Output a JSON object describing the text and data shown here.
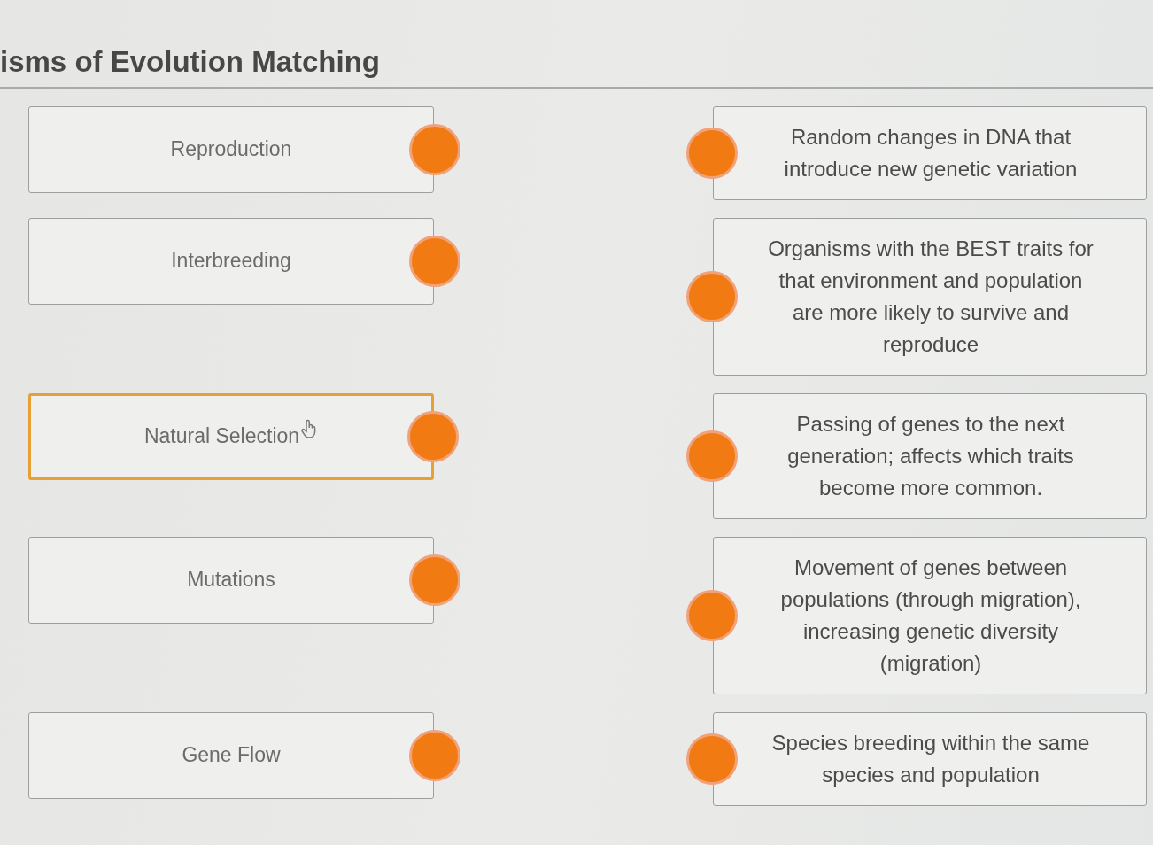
{
  "title": "isms of Evolution Matching",
  "terms": [
    {
      "label": "Reproduction",
      "selected": false
    },
    {
      "label": "Interbreeding",
      "selected": false
    },
    {
      "label": "Natural Selection",
      "selected": true
    },
    {
      "label": "Mutations",
      "selected": false
    },
    {
      "label": "Gene Flow",
      "selected": false
    }
  ],
  "definitions": [
    {
      "text": "Random changes in DNA that introduce new genetic variation"
    },
    {
      "text": "Organisms with the BEST traits for that environment and population are more likely to survive and reproduce"
    },
    {
      "text": "Passing of genes to the next generation; affects which traits become more common."
    },
    {
      "text": "Movement of genes between populations (through migration), increasing genetic diversity (migration)"
    },
    {
      "text": "Species breeding within the same species and population"
    }
  ]
}
